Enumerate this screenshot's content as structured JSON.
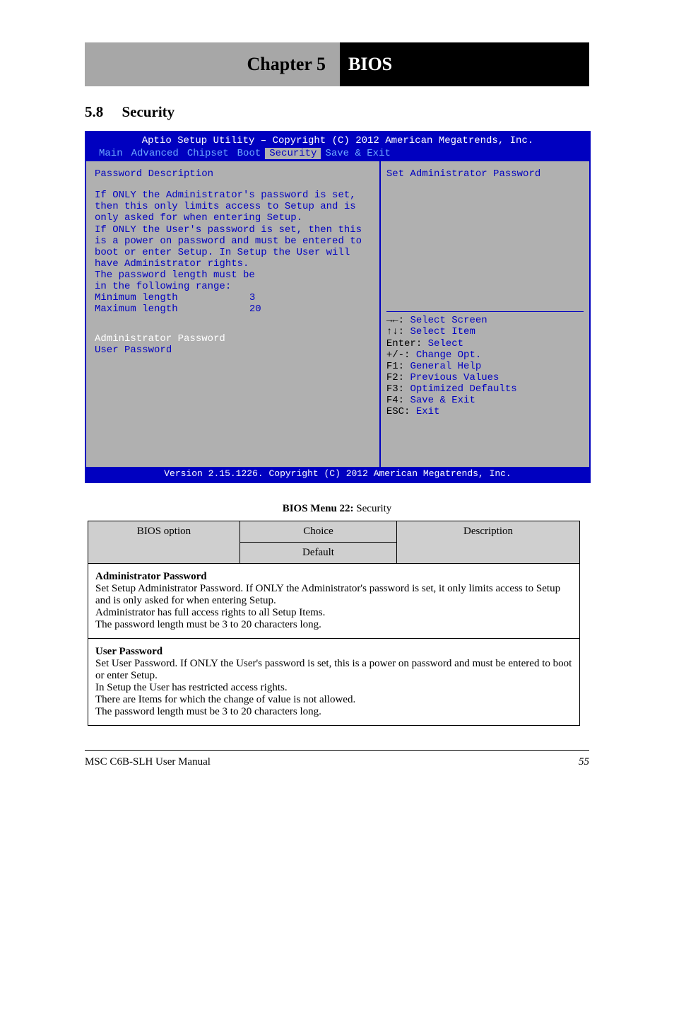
{
  "chapter": {
    "left": "Chapter 5",
    "right": "BIOS"
  },
  "section": {
    "num": "5.8",
    "title": "Security"
  },
  "bios": {
    "title": "Aptio Setup Utility – Copyright (C) 2012 American Megatrends, Inc.",
    "tabs": [
      "Main",
      "Advanced",
      "Chipset",
      "Boot",
      "Security",
      "Save & Exit"
    ],
    "active_tab": 4,
    "left": {
      "heading": "Password Description",
      "desc": [
        "If ONLY the Administrator's password is set,",
        "then this only limits access to Setup and is",
        "only asked for when entering Setup.",
        "If ONLY the User's password is set, then this",
        "is a power on password and must be entered to",
        "boot or enter Setup. In Setup the User will",
        "have Administrator rights.",
        "The password length must be",
        "in the following range:"
      ],
      "min_label": "Minimum length",
      "min_val": "3",
      "max_label": "Maximum length",
      "max_val": "20",
      "items": [
        "Administrator Password",
        "User Password"
      ]
    },
    "right": {
      "help": "Set Administrator Password",
      "hints": [
        {
          "k": "→←:",
          "t": "Select Screen"
        },
        {
          "k": "↑↓:",
          "t": "Select Item"
        },
        {
          "k": "Enter:",
          "t": "Select"
        },
        {
          "k": "+/-:",
          "t": "Change Opt."
        },
        {
          "k": "F1:",
          "t": "General Help"
        },
        {
          "k": "F2:",
          "t": "Previous Values"
        },
        {
          "k": "F3:",
          "t": "Optimized Defaults"
        },
        {
          "k": "F4:",
          "t": "Save & Exit"
        },
        {
          "k": "ESC:",
          "t": "Exit"
        }
      ]
    },
    "footer": "Version 2.15.1226. Copyright (C) 2012 American Megatrends, Inc."
  },
  "table": {
    "caption_label": "BIOS Menu 22:",
    "caption_text": "Security",
    "h_option": "BIOS option",
    "h_choice": "Choice",
    "h_desc": "Description",
    "h_default": "Default",
    "rows": [
      {
        "option": "Administrator Password",
        "desc": "Set Setup Administrator Password. If ONLY the Administrator's password is set, it only limits access to Setup and is only asked for when entering Setup.\nAdministrator has full access rights to all Setup Items.\nThe password length must be 3 to 20 characters long.",
        "colspan": 3
      },
      {
        "option": "User Password",
        "desc": "Set User Password. If ONLY the User's password is set, this is a power on password and must be entered to boot or enter Setup.\nIn Setup the User has restricted access rights.\nThere are Items for which the change of value is not allowed.\nThe password length must be 3 to 20 characters long.",
        "colspan": 3
      }
    ]
  },
  "footer": {
    "doc": "MSC C6B-SLH User Manual",
    "page": "55"
  }
}
